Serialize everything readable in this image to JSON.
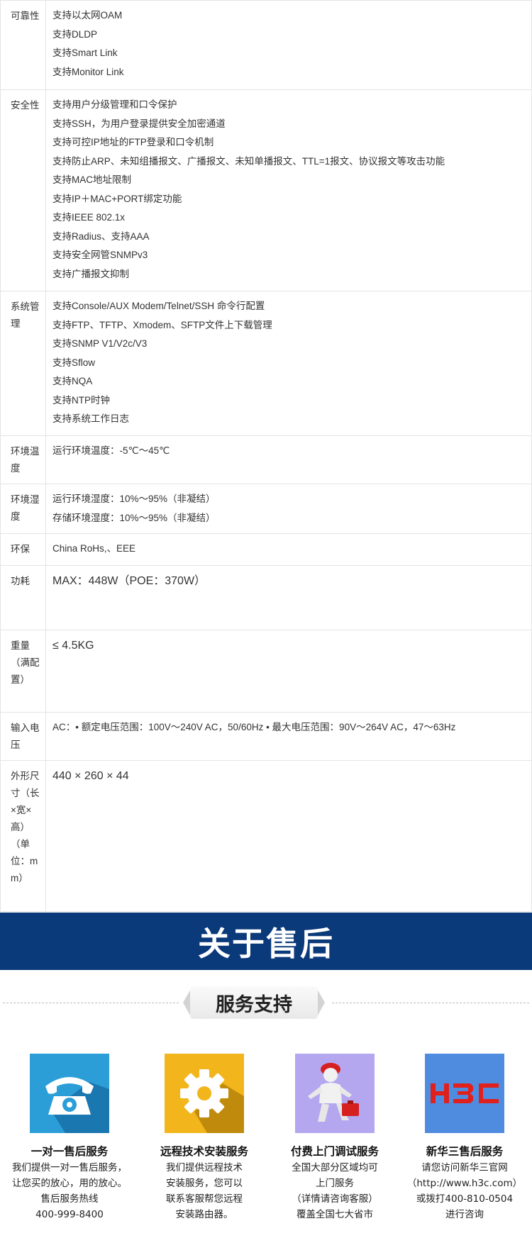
{
  "specs": [
    {
      "name": "可靠性",
      "values": [
        "支持以太网OAM",
        "支持DLDP",
        "支持Smart Link",
        "支持Monitor Link"
      ]
    },
    {
      "name": "安全性",
      "values": [
        "支持用户分级管理和口令保护",
        "支持SSH，为用户登录提供安全加密通道",
        "支持可控IP地址的FTP登录和口令机制",
        "支持防止ARP、未知组播报文、广播报文、未知单播报文、TTL=1报文、协议报文等攻击功能",
        "支持MAC地址限制",
        "支持IP＋MAC+PORT绑定功能",
        "支持IEEE 802.1x",
        "支持Radius、支持AAA",
        "支持安全网管SNMPv3",
        "支持广播报文抑制"
      ]
    },
    {
      "name": "系统管理",
      "values": [
        "支持Console/AUX Modem/Telnet/SSH 命令行配置",
        "支持FTP、TFTP、Xmodem、SFTP文件上下载管理",
        "支持SNMP V1/V2c/V3",
        "支持Sflow",
        "支持NQA",
        "支持NTP时钟",
        "支持系统工作日志"
      ]
    },
    {
      "name": "环境温度",
      "values": [
        "运行环境温度：-5℃～45℃"
      ]
    },
    {
      "name": "环境湿度",
      "values": [
        "运行环境湿度：10%～95%（非凝结）",
        "存储环境湿度：10%～95%（非凝结）"
      ]
    },
    {
      "name": "环保",
      "values": [
        "China RoHs,、EEE"
      ]
    },
    {
      "name": "功耗",
      "values": [
        "MAX：448W（POE：370W）"
      ]
    },
    {
      "name": "重量（满配置）",
      "values": [
        "≤ 4.5KG"
      ]
    },
    {
      "name": "输入电压",
      "values": [
        "AC：• 额定电压范围：100V～240V AC，50/60Hz • 最大电压范围：90V～264V AC，47～63Hz"
      ]
    },
    {
      "name": "外形尺寸（长×宽×高）（单位：mm）",
      "values": [
        "440 × 260 × 44"
      ]
    }
  ],
  "banner": {
    "title": "关于售后"
  },
  "section": {
    "title": "服务支持"
  },
  "services": [
    {
      "icon": "telephone-icon",
      "title": "一对一售后服务",
      "lines": [
        "我们提供一对一售后服务，",
        "让您买的放心，用的放心。",
        "售后服务热线",
        "400-999-8400"
      ]
    },
    {
      "icon": "gear-icon",
      "title": "远程技术安装服务",
      "lines": [
        "我们提供远程技术",
        "安装服务，您可以",
        "联系客服帮您远程",
        "安装路由器。"
      ]
    },
    {
      "icon": "technician-icon",
      "title": "付费上门调试服务",
      "lines": [
        "全国大部分区域均可",
        "上门服务",
        "（详情请咨询客服）",
        "覆盖全国七大省市"
      ]
    },
    {
      "icon": "h3c-logo",
      "title": "新华三售后服务",
      "lines": [
        "请您访问新华三官网",
        "（http://www.h3c.com）",
        "或拨打400-810-0504",
        "进行咨询"
      ]
    }
  ],
  "colors": {
    "banner": "#0b3a7a",
    "phone_tile": "#2b9ed8",
    "gear_tile": "#f2b51c",
    "tech_tile": "#b4a7f0",
    "h3c_tile": "#4f8ce0",
    "h3c_logo": "#e0201c"
  }
}
